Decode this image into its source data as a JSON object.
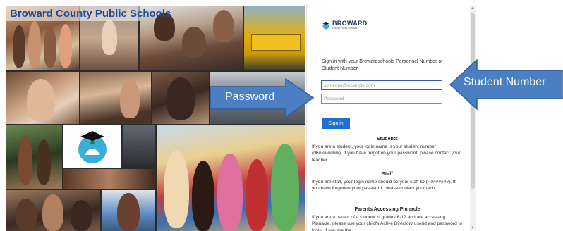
{
  "collage": {
    "title": "Broward County Public Schools"
  },
  "panel": {
    "brand_name": "BROWARD",
    "brand_sub": "County Public Schools",
    "prompt": "Sign in with your Browardschools Personnel Number or Student Number",
    "username_placeholder": "someone@example.com",
    "password_placeholder": "Password",
    "signin_label": "Sign in"
  },
  "help": {
    "students": {
      "heading": "Students",
      "body": "If you are a student, your login name is your student number (06########). If you have forgotten your password, please contact your teacher."
    },
    "staff": {
      "heading": "Staff",
      "body": "If you are staff, your login name should be your staff ID (P0######). If you have forgotten your password, please contact your tech."
    },
    "parents": {
      "heading": "Parents Accessing Pinnacle",
      "body": "If you are a parent of a student in grades 6-12 and are accessing Pinnacle, please use your child's Active Directory userid and password to login. If you are the"
    }
  },
  "callouts": {
    "password": "Password",
    "student_number": "Student Number"
  },
  "colors": {
    "arrow_fill": "#4a7fc1",
    "arrow_stroke": "#2f5f9e",
    "brand_blue": "#1a4c9a",
    "button_blue": "#1f6ed4"
  },
  "icons": {
    "logo": "school-mascot-icon"
  }
}
